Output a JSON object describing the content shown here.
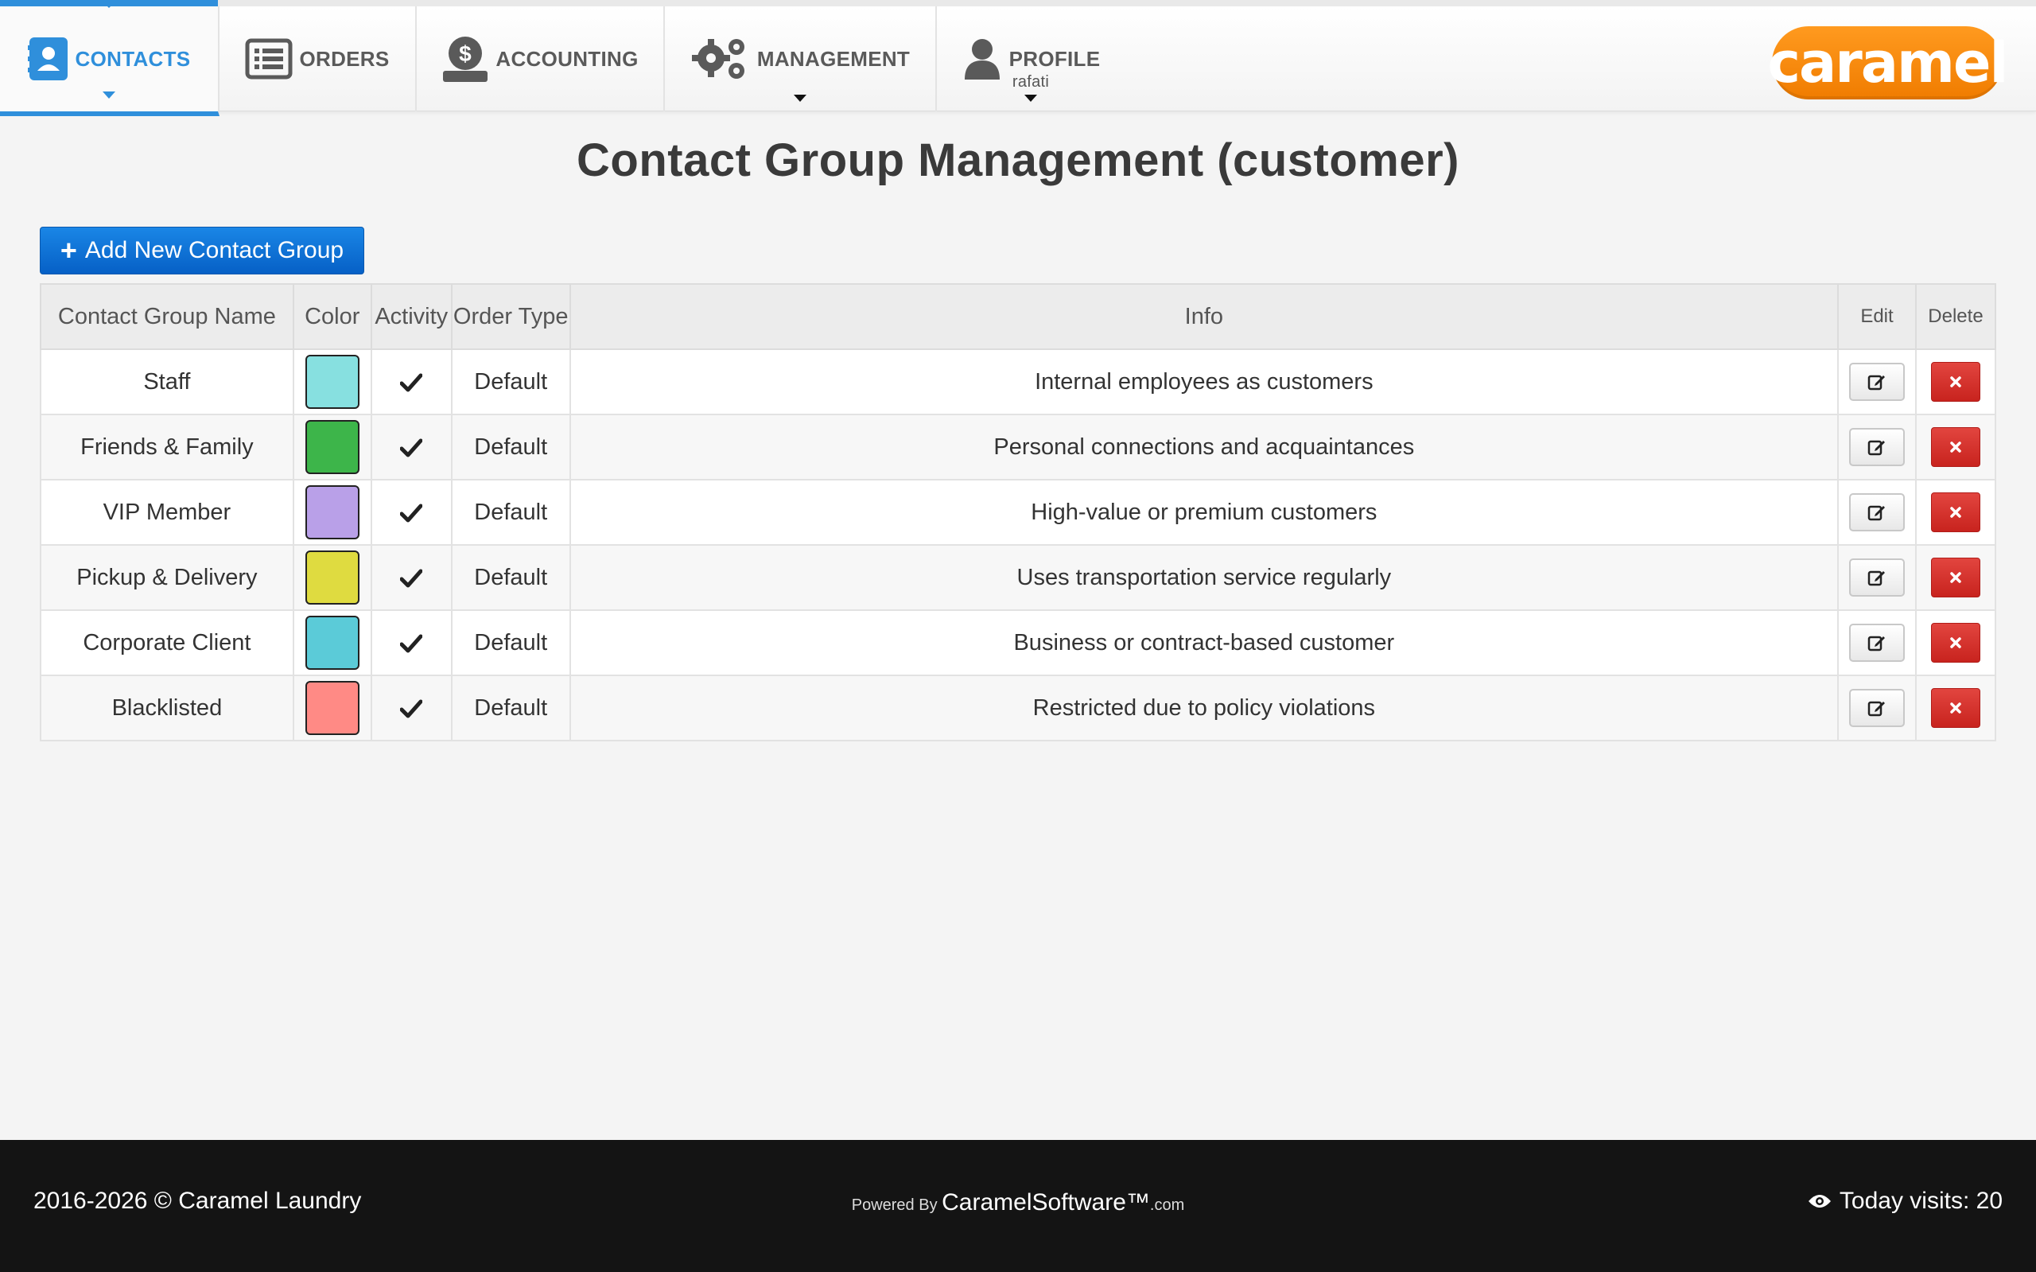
{
  "nav": {
    "items": [
      {
        "label": "CONTACTS",
        "icon": "contact-card-icon"
      },
      {
        "label": "ORDERS",
        "icon": "list-icon"
      },
      {
        "label": "ACCOUNTING",
        "icon": "money-bag-icon"
      },
      {
        "label": "MANAGEMENT",
        "icon": "gears-icon"
      },
      {
        "label": "PROFILE",
        "icon": "user-icon",
        "sub": "rafati"
      }
    ],
    "active": "CONTACTS",
    "logo_text": "caramel"
  },
  "page": {
    "title": "Contact Group Management (customer)",
    "add_button_label": "Add New Contact Group"
  },
  "table": {
    "headers": {
      "name": "Contact Group Name",
      "color": "Color",
      "activity": "Activity",
      "order_type": "Order Type",
      "info": "Info",
      "edit": "Edit",
      "delete": "Delete"
    },
    "rows": [
      {
        "name": "Staff",
        "color": "#87e0e0",
        "active": true,
        "order_type": "Default",
        "info": "Internal employees as customers"
      },
      {
        "name": "Friends & Family",
        "color": "#3db54a",
        "active": true,
        "order_type": "Default",
        "info": "Personal connections and acquaintances"
      },
      {
        "name": "VIP Member",
        "color": "#b9a0e8",
        "active": true,
        "order_type": "Default",
        "info": "High-value or premium customers"
      },
      {
        "name": "Pickup & Delivery",
        "color": "#dfdb40",
        "active": true,
        "order_type": "Default",
        "info": "Uses transportation service regularly"
      },
      {
        "name": "Corporate Client",
        "color": "#5bcbd8",
        "active": true,
        "order_type": "Default",
        "info": "Business or contract-based customer"
      },
      {
        "name": "Blacklisted",
        "color": "#ff8a85",
        "active": true,
        "order_type": "Default",
        "info": "Restricted due to policy violations"
      }
    ]
  },
  "footer": {
    "copyright": "2016-2026 © Caramel Laundry",
    "powered_by": "Powered By",
    "brand": "CaramelSoftware™",
    "dotcom": ".com",
    "visits": "Today visits: 20"
  },
  "colors": {
    "accent": "#2f8fdb",
    "add_button": "#0a6fd8",
    "delete_button": "#d32f2a",
    "logo": "#f78a0c",
    "footer_bg": "#141414"
  }
}
